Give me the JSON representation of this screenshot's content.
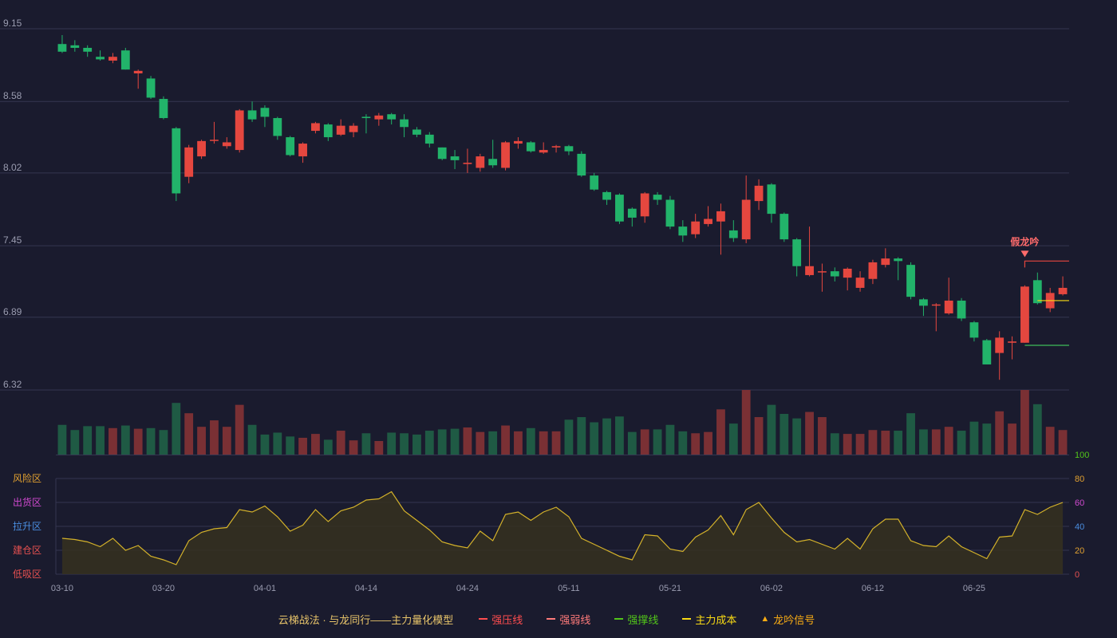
{
  "chart_data": {
    "type": "candlestick",
    "price_axis": {
      "ticks": [
        "9.15",
        "8.58",
        "8.02",
        "7.45",
        "6.89",
        "6.32"
      ],
      "ylim": [
        6.32,
        9.15
      ]
    },
    "x_tick_labels": [
      {
        "index": 0,
        "label": "03-10"
      },
      {
        "index": 8,
        "label": "03-20"
      },
      {
        "index": 16,
        "label": "04-01"
      },
      {
        "index": 24,
        "label": "04-14"
      },
      {
        "index": 32,
        "label": "04-24"
      },
      {
        "index": 40,
        "label": "05-11"
      },
      {
        "index": 48,
        "label": "05-21"
      },
      {
        "index": 56,
        "label": "06-02"
      },
      {
        "index": 64,
        "label": "06-12"
      },
      {
        "index": 72,
        "label": "06-25"
      }
    ],
    "candles": [
      [
        9.03,
        8.97,
        9.1,
        8.96
      ],
      [
        9.02,
        9.0,
        9.06,
        8.97
      ],
      [
        9.0,
        8.97,
        9.02,
        8.93
      ],
      [
        8.93,
        8.91,
        8.98,
        8.9
      ],
      [
        8.9,
        8.93,
        8.96,
        8.88
      ],
      [
        8.98,
        8.83,
        9.0,
        8.83
      ],
      [
        8.8,
        8.82,
        8.83,
        8.68
      ],
      [
        8.76,
        8.61,
        8.78,
        8.6
      ],
      [
        8.6,
        8.45,
        8.62,
        8.44
      ],
      [
        8.37,
        7.86,
        8.38,
        7.8
      ],
      [
        7.99,
        8.22,
        8.24,
        7.94
      ],
      [
        8.15,
        8.27,
        8.28,
        8.13
      ],
      [
        8.28,
        8.28,
        8.42,
        8.25
      ],
      [
        8.23,
        8.26,
        8.3,
        8.21
      ],
      [
        8.2,
        8.51,
        8.52,
        8.18
      ],
      [
        8.51,
        8.44,
        8.58,
        8.42
      ],
      [
        8.53,
        8.46,
        8.55,
        8.38
      ],
      [
        8.45,
        8.31,
        8.46,
        8.28
      ],
      [
        8.3,
        8.16,
        8.31,
        8.15
      ],
      [
        8.15,
        8.25,
        8.26,
        8.1
      ],
      [
        8.35,
        8.41,
        8.42,
        8.33
      ],
      [
        8.4,
        8.3,
        8.41,
        8.27
      ],
      [
        8.32,
        8.39,
        8.44,
        8.31
      ],
      [
        8.34,
        8.39,
        8.41,
        8.3
      ],
      [
        8.46,
        8.45,
        8.48,
        8.33
      ],
      [
        8.44,
        8.47,
        8.49,
        8.39
      ],
      [
        8.48,
        8.44,
        8.49,
        8.4
      ],
      [
        8.44,
        8.38,
        8.48,
        8.3
      ],
      [
        8.36,
        8.32,
        8.38,
        8.3
      ],
      [
        8.32,
        8.25,
        8.34,
        8.22
      ],
      [
        8.22,
        8.13,
        8.22,
        8.12
      ],
      [
        8.15,
        8.12,
        8.2,
        8.05
      ],
      [
        8.09,
        8.1,
        8.21,
        8.02
      ],
      [
        8.06,
        8.15,
        8.17,
        8.03
      ],
      [
        8.13,
        8.08,
        8.28,
        8.06
      ],
      [
        8.06,
        8.26,
        8.27,
        8.04
      ],
      [
        8.25,
        8.27,
        8.3,
        8.21
      ],
      [
        8.26,
        8.19,
        8.27,
        8.18
      ],
      [
        8.18,
        8.2,
        8.26,
        8.17
      ],
      [
        8.22,
        8.23,
        8.24,
        8.18
      ],
      [
        8.23,
        8.19,
        8.24,
        8.16
      ],
      [
        8.17,
        8.0,
        8.19,
        7.99
      ],
      [
        8.0,
        7.89,
        8.02,
        7.88
      ],
      [
        7.87,
        7.81,
        7.88,
        7.77
      ],
      [
        7.85,
        7.64,
        7.86,
        7.62
      ],
      [
        7.74,
        7.67,
        7.75,
        7.6
      ],
      [
        7.68,
        7.86,
        7.87,
        7.63
      ],
      [
        7.85,
        7.81,
        7.87,
        7.77
      ],
      [
        7.81,
        7.6,
        7.84,
        7.58
      ],
      [
        7.6,
        7.53,
        7.65,
        7.48
      ],
      [
        7.54,
        7.64,
        7.7,
        7.51
      ],
      [
        7.62,
        7.66,
        7.76,
        7.6
      ],
      [
        7.64,
        7.72,
        7.78,
        7.38
      ],
      [
        7.57,
        7.51,
        7.65,
        7.48
      ],
      [
        7.5,
        7.81,
        8.0,
        7.47
      ],
      [
        7.8,
        7.92,
        7.97,
        7.73
      ],
      [
        7.93,
        7.7,
        7.94,
        7.63
      ],
      [
        7.7,
        7.5,
        7.71,
        7.48
      ],
      [
        7.5,
        7.29,
        7.51,
        7.21
      ],
      [
        7.22,
        7.29,
        7.6,
        7.21
      ],
      [
        7.25,
        7.25,
        7.31,
        7.09
      ],
      [
        7.25,
        7.21,
        7.28,
        7.17
      ],
      [
        7.2,
        7.27,
        7.28,
        7.1
      ],
      [
        7.12,
        7.2,
        7.25,
        7.09
      ],
      [
        7.19,
        7.32,
        7.34,
        7.15
      ],
      [
        7.3,
        7.35,
        7.43,
        7.28
      ],
      [
        7.35,
        7.33,
        7.36,
        7.18
      ],
      [
        7.3,
        7.05,
        7.32,
        7.03
      ],
      [
        7.03,
        6.98,
        7.04,
        6.9
      ],
      [
        6.99,
        6.99,
        7.0,
        6.78
      ],
      [
        6.92,
        7.02,
        7.2,
        6.91
      ],
      [
        7.02,
        6.88,
        7.04,
        6.86
      ],
      [
        6.85,
        6.73,
        6.86,
        6.7
      ],
      [
        6.71,
        6.52,
        6.72,
        6.52
      ],
      [
        6.61,
        6.73,
        6.78,
        6.4
      ],
      [
        6.69,
        6.7,
        6.74,
        6.56
      ],
      [
        6.69,
        7.13,
        7.14,
        6.69
      ],
      [
        7.18,
        7.0,
        7.24,
        6.99
      ],
      [
        6.96,
        7.08,
        7.12,
        6.93
      ],
      [
        7.07,
        7.12,
        7.21,
        7.06
      ]
    ],
    "volume": [
      46,
      38,
      44,
      44,
      41,
      45,
      40,
      41,
      38,
      80,
      64,
      43,
      53,
      43,
      77,
      46,
      31,
      34,
      28,
      26,
      32,
      23,
      37,
      22,
      33,
      21,
      34,
      33,
      31,
      37,
      39,
      40,
      42,
      35,
      36,
      45,
      36,
      41,
      36,
      36,
      54,
      58,
      50,
      56,
      59,
      35,
      39,
      39,
      46,
      36,
      33,
      35,
      70,
      48,
      100,
      58,
      77,
      63,
      56,
      66,
      58,
      33,
      32,
      32,
      38,
      37,
      37,
      64,
      39,
      39,
      43,
      37,
      51,
      48,
      67,
      48,
      100,
      78,
      43,
      38
    ],
    "indicator": {
      "axis_ticks": [
        "0",
        "20",
        "40",
        "60",
        "80",
        "100"
      ],
      "zones": [
        "风险区",
        "出货区",
        "拉升区",
        "建仓区",
        "低吸区"
      ],
      "values": [
        30,
        29,
        27,
        23,
        30,
        20,
        24,
        15,
        12,
        8,
        28,
        35,
        38,
        39,
        54,
        52,
        57,
        48,
        36,
        41,
        54,
        44,
        53,
        56,
        62,
        63,
        69,
        53,
        45,
        37,
        27,
        24,
        22,
        36,
        28,
        50,
        52,
        45,
        52,
        56,
        48,
        30,
        25,
        20,
        15,
        12,
        33,
        32,
        21,
        19,
        31,
        37,
        49,
        33,
        54,
        60,
        47,
        35,
        27,
        29,
        25,
        21,
        30,
        21,
        38,
        46,
        46,
        28,
        24,
        23,
        32,
        23,
        18,
        13,
        31,
        32,
        54,
        50,
        56,
        60
      ]
    },
    "annotation": {
      "label": "假龙吟",
      "index": 76,
      "price": 7.33
    },
    "strong_pressure_line": {
      "value": 7.33,
      "from_index": 76
    },
    "support_line": {
      "value": 6.67,
      "from_index": 76
    },
    "main_cost_line": {
      "value": 7.02,
      "from_index": 77
    },
    "colors": {
      "up": "#e5473f",
      "down": "#22b36a",
      "up_volume": "#7a3034",
      "down_volume": "#1f5a44",
      "grid": "#343650",
      "axis_text": "#9a9cb0",
      "indicator_line": "#d4b22a",
      "indicator_fill": "#36301f"
    }
  },
  "legend": {
    "title": "云梯战法 · 与龙同行——主力量化模型",
    "items": [
      {
        "label": "强压线",
        "color": "#ff4d4f",
        "style": "solid"
      },
      {
        "label": "强弱线",
        "color": "#ff7a7a",
        "style": "dashed"
      },
      {
        "label": "强撑线",
        "color": "#52c41a",
        "style": "solid"
      },
      {
        "label": "主力成本",
        "color": "#fadb14",
        "style": "dashed"
      },
      {
        "label": "龙吟信号",
        "color": "#faad14",
        "style": "triangle"
      }
    ]
  }
}
